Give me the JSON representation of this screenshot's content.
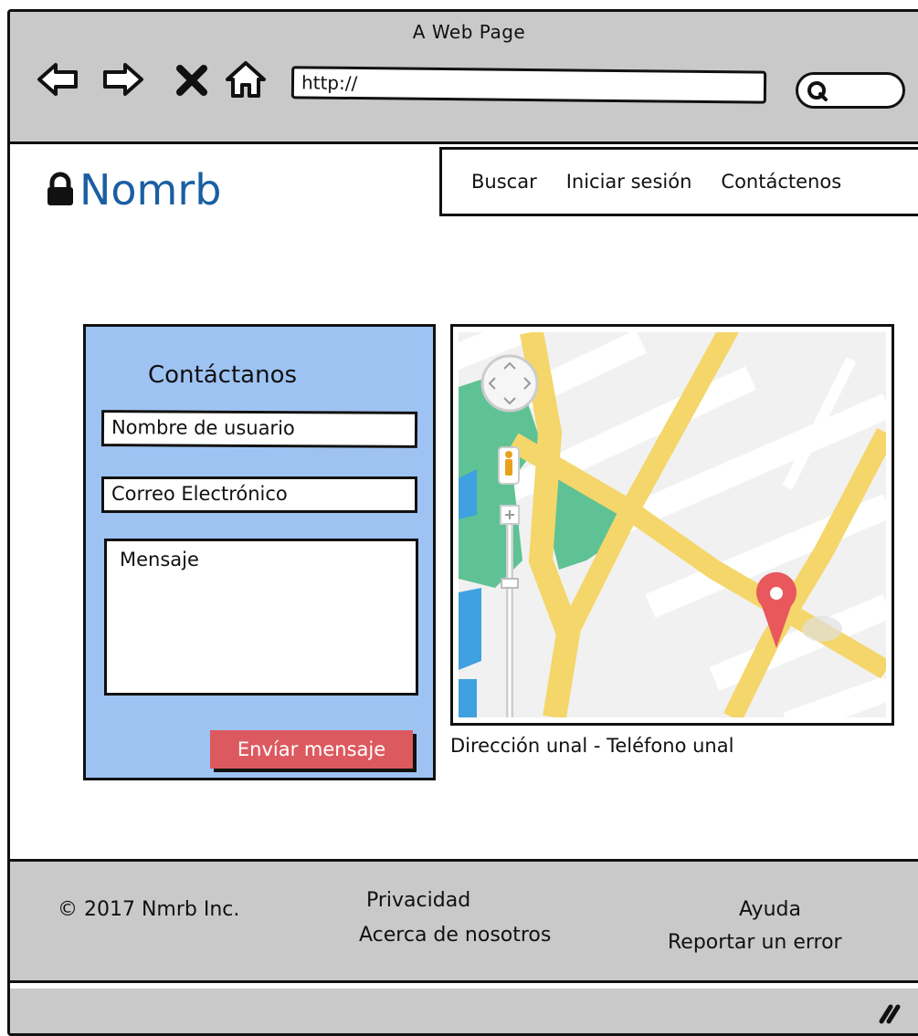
{
  "browser": {
    "title": "A Web Page",
    "url": "http://",
    "icons": [
      "back-arrow-icon",
      "forward-arrow-icon",
      "stop-icon",
      "home-icon",
      "search-icon"
    ]
  },
  "header": {
    "logo_text": "Nomrb",
    "logo_color": "#1a5fa3",
    "nav": [
      {
        "label": "Buscar"
      },
      {
        "label": "Iniciar sesión"
      },
      {
        "label": "Contáctenos"
      }
    ]
  },
  "contact_form": {
    "title": "Contáctanos",
    "username_value": "Nombre de usuario",
    "email_value": "Correo Electrónico",
    "message_value": "Mensaje",
    "send_label": "Envíar mensaje",
    "panel_color": "#9ec3f3",
    "button_color": "#dc5a5f"
  },
  "map": {
    "caption": "Dirección unal - Teléfono unal",
    "marker_color": "#e8585c",
    "road_color": "#f4d66a",
    "park_color": "#5ec294"
  },
  "footer": {
    "copyright": "© 2017 Nmrb Inc.",
    "privacy": "Privacidad",
    "about": "Acerca de nosotros",
    "help": "Ayuda",
    "report": "Reportar un error"
  }
}
